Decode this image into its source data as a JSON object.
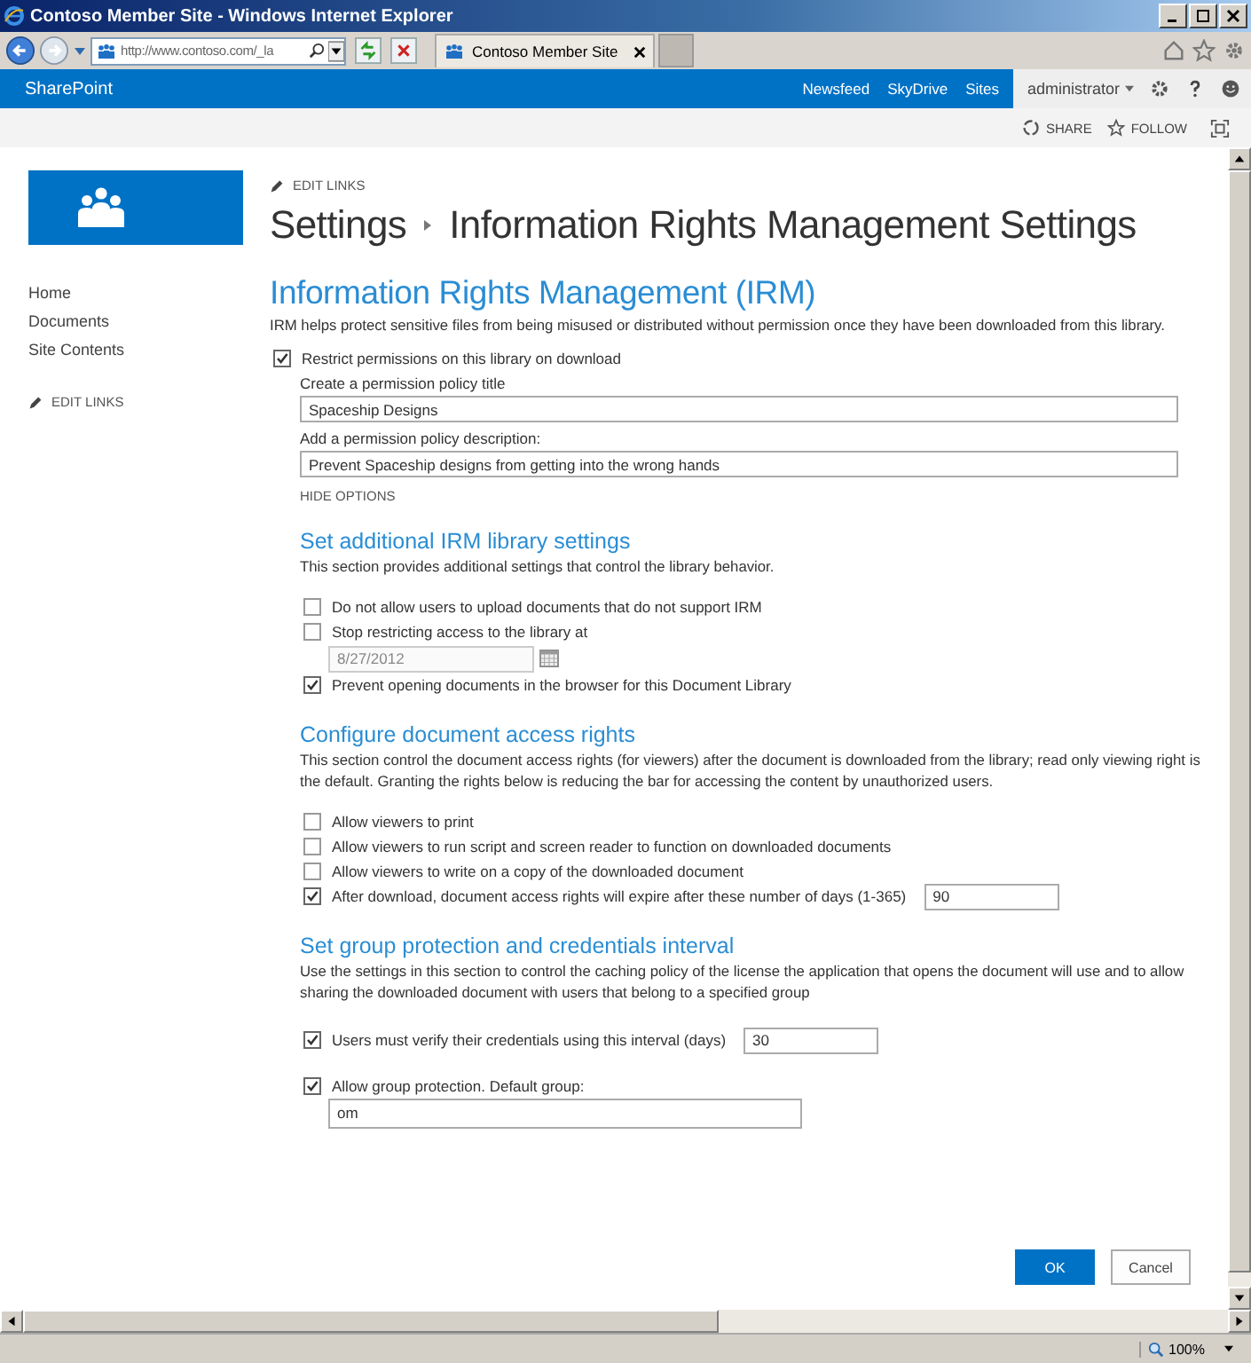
{
  "window": {
    "title": "Contoso Member Site - Windows Internet Explorer"
  },
  "address_bar": {
    "value": "http://www.contoso.com/_la"
  },
  "tabs": [
    {
      "label": "Contoso Member Site",
      "selected": true
    }
  ],
  "suite_bar": {
    "brand": "SharePoint",
    "links": [
      "Newsfeed",
      "SkyDrive",
      "Sites"
    ],
    "user": "administrator"
  },
  "ribbon": {
    "actions": [
      {
        "kind": "share",
        "label": "SHARE"
      },
      {
        "kind": "follow",
        "label": "FOLLOW"
      }
    ]
  },
  "sidebar": {
    "items": [
      "Home",
      "Documents",
      "Site Contents"
    ],
    "edit_links": "EDIT LINKS"
  },
  "header": {
    "edit_links": "EDIT LINKS",
    "breadcrumb": [
      "Settings",
      "Information Rights Management Settings"
    ]
  },
  "page": {
    "title": "Information Rights Management (IRM)",
    "description": "IRM helps protect sensitive files from being misused or distributed without permission once they have been downloaded from this library."
  },
  "restrict": {
    "label": "Restrict permissions on this library on download",
    "checked": true
  },
  "policy_title": {
    "label": "Create a permission policy title",
    "value": "Spaceship Designs"
  },
  "policy_description": {
    "label": "Add a permission policy description:",
    "value": "Prevent Spaceship designs from getting into the wrong hands"
  },
  "hide_options": "HIDE OPTIONS",
  "sections": [
    {
      "title": "Set additional IRM library settings",
      "description": "This section provides additional settings that control the library behavior.",
      "options": [
        {
          "kind": "plain",
          "label": "Do not allow users to upload documents that do not support IRM",
          "checked": false
        },
        {
          "kind": "date",
          "label": "Stop restricting access to the library at",
          "checked": false,
          "value": "8/27/2012"
        },
        {
          "kind": "plain",
          "label": "Prevent opening documents in the browser for this Document Library",
          "checked": true
        }
      ]
    },
    {
      "title": "Configure document access rights",
      "description": "This section control the document access rights (for viewers) after the document is downloaded from the library; read only viewing right is the default. Granting the rights below is reducing the bar for accessing the content by unauthorized users.",
      "options": [
        {
          "kind": "plain",
          "label": "Allow viewers to print",
          "checked": false
        },
        {
          "kind": "plain",
          "label": "Allow viewers to run script and screen reader to function on downloaded documents",
          "checked": false
        },
        {
          "kind": "plain",
          "label": "Allow viewers to write on a copy of the downloaded document",
          "checked": false
        },
        {
          "kind": "inline",
          "label": "After download, document access rights will expire after these number of days (1-365)",
          "checked": true,
          "value": "90"
        }
      ]
    },
    {
      "title": "Set group protection and credentials interval",
      "description": "Use the settings in this section to control the caching policy of the license the application that opens the document will use and to allow sharing the downloaded document with users that belong to a specified group",
      "options": [
        {
          "kind": "inline",
          "label": "Users must verify their credentials using this interval (days)",
          "checked": true,
          "value": "30"
        },
        {
          "kind": "below",
          "label": "Allow group protection. Default group:",
          "checked": true,
          "value": "om"
        }
      ]
    }
  ],
  "buttons": [
    {
      "kind": "primary",
      "label": "OK"
    },
    {
      "kind": "secondary",
      "label": "Cancel"
    }
  ],
  "status_bar": {
    "zoom": "100%"
  }
}
